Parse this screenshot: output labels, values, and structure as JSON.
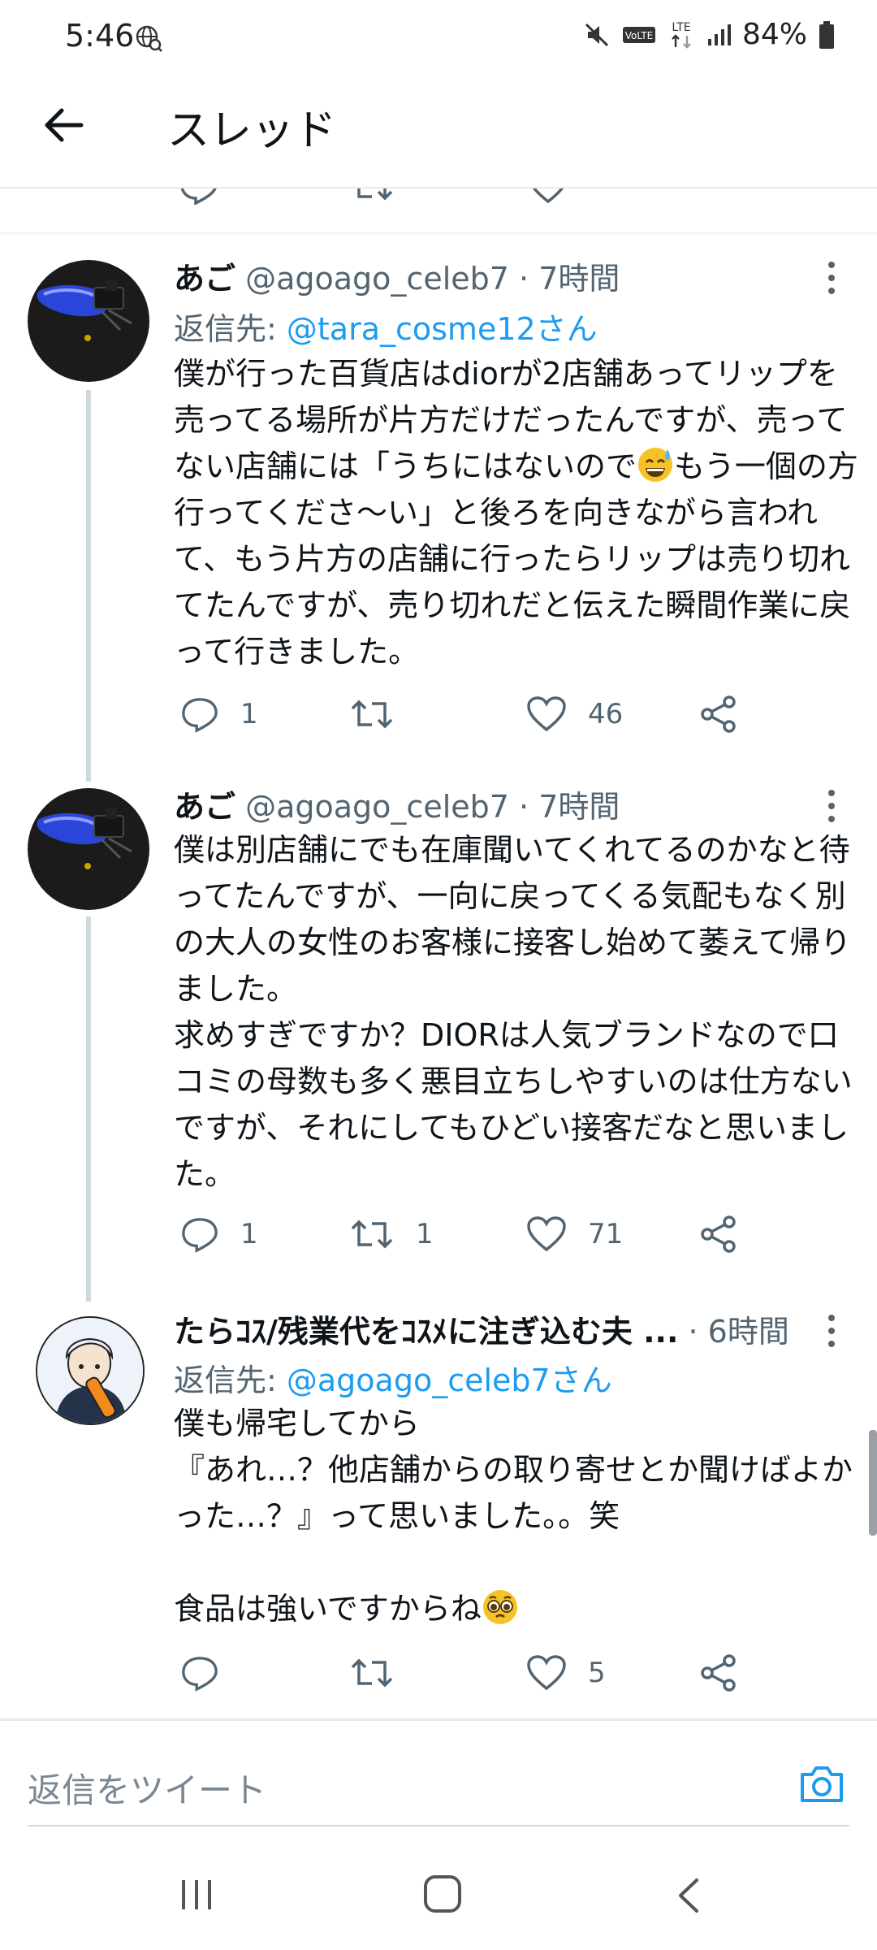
{
  "status_bar": {
    "time": "5:46",
    "battery": "84%",
    "network": "LTE",
    "volte": "VoLTE",
    "icons": [
      "globe-icon",
      "mute-icon",
      "volte-icon",
      "lte-icon",
      "signal-icon",
      "battery-icon"
    ]
  },
  "header": {
    "title": "スレッド"
  },
  "tweets": [
    {
      "name": "あご",
      "handle": "@agoago_celeb7",
      "time": "7時間",
      "reply_prefix": "返信先: ",
      "reply_to": "@tara_cosme12さん",
      "text_a": "僕が行った百貨店はdiorが2店舗あってリップを売ってる場所が片方だけだったんですが、売ってない店舗には「うちにはないので",
      "emoji": "sweat-smile-emoji",
      "text_b": "もう一個の方行ってくださ〜い」と後ろを向きながら言われて、もう片方の店舗に行ったらリップは売り切れてたんですが、売り切れだと伝えた瞬間作業に戻って行きました。",
      "replies": "1",
      "retweets": "",
      "likes": "46"
    },
    {
      "name": "あご",
      "handle": "@agoago_celeb7",
      "time": "7時間",
      "text": "僕は別店舗にでも在庫聞いてくれてるのかなと待ってたんですが、一向に戻ってくる気配もなく別の大人の女性のお客様に接客し始めて萎えて帰りました。\n求めすぎですか？DIORは人気ブランドなので口コミの母数も多く悪目立ちしやすいのは仕方ないですが、それにしてもひどい接客だなと思いました。",
      "replies": "1",
      "retweets": "1",
      "likes": "71"
    },
    {
      "name": "たらｺｽ/残業代をｺｽﾒに注ぎ込む夫 ...",
      "time": "6時間",
      "reply_prefix": "返信先: ",
      "reply_to": "@agoago_celeb7さん",
      "text_a": "僕も帰宅してから\n『あれ…？他店舗からの取り寄せとか聞けばよかった…？』って思いました。。笑\n\n食品は強いですからね",
      "emoji": "pleading-face-emoji",
      "replies": "",
      "retweets": "",
      "likes": "5"
    }
  ],
  "composer": {
    "placeholder": "返信をツイート"
  },
  "colors": {
    "accent": "#1d9bf0",
    "text": "#0f1419",
    "muted": "#536471"
  }
}
